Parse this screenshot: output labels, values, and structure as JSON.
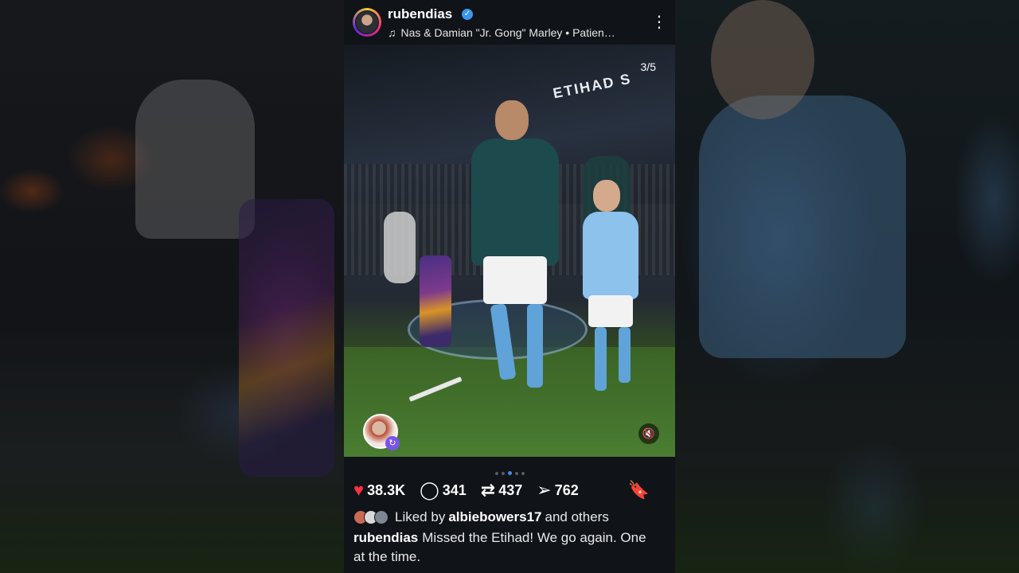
{
  "post": {
    "username": "rubendias",
    "verified_icon": "verified-badge-icon",
    "music": "Nas & Damian \"Jr. Gong\" Marley • Patien…",
    "slide_counter": "3/5",
    "etihad_sign": "ETIHAD S",
    "carousel": {
      "total": 5,
      "active_index": 2
    },
    "actions": {
      "likes": "38.3K",
      "comments": "341",
      "reposts": "437",
      "shares": "762"
    },
    "liked_by": {
      "prefix": "Liked by",
      "user": "albiebowers17",
      "suffix": "and others"
    },
    "caption": {
      "user": "rubendias",
      "text": "Missed the Etihad! We go again. One at the time."
    }
  },
  "colors": {
    "like_red": "#ff3040",
    "verified_blue": "#3897f0",
    "dot_active": "#3f8bf0",
    "background": "#101318"
  }
}
